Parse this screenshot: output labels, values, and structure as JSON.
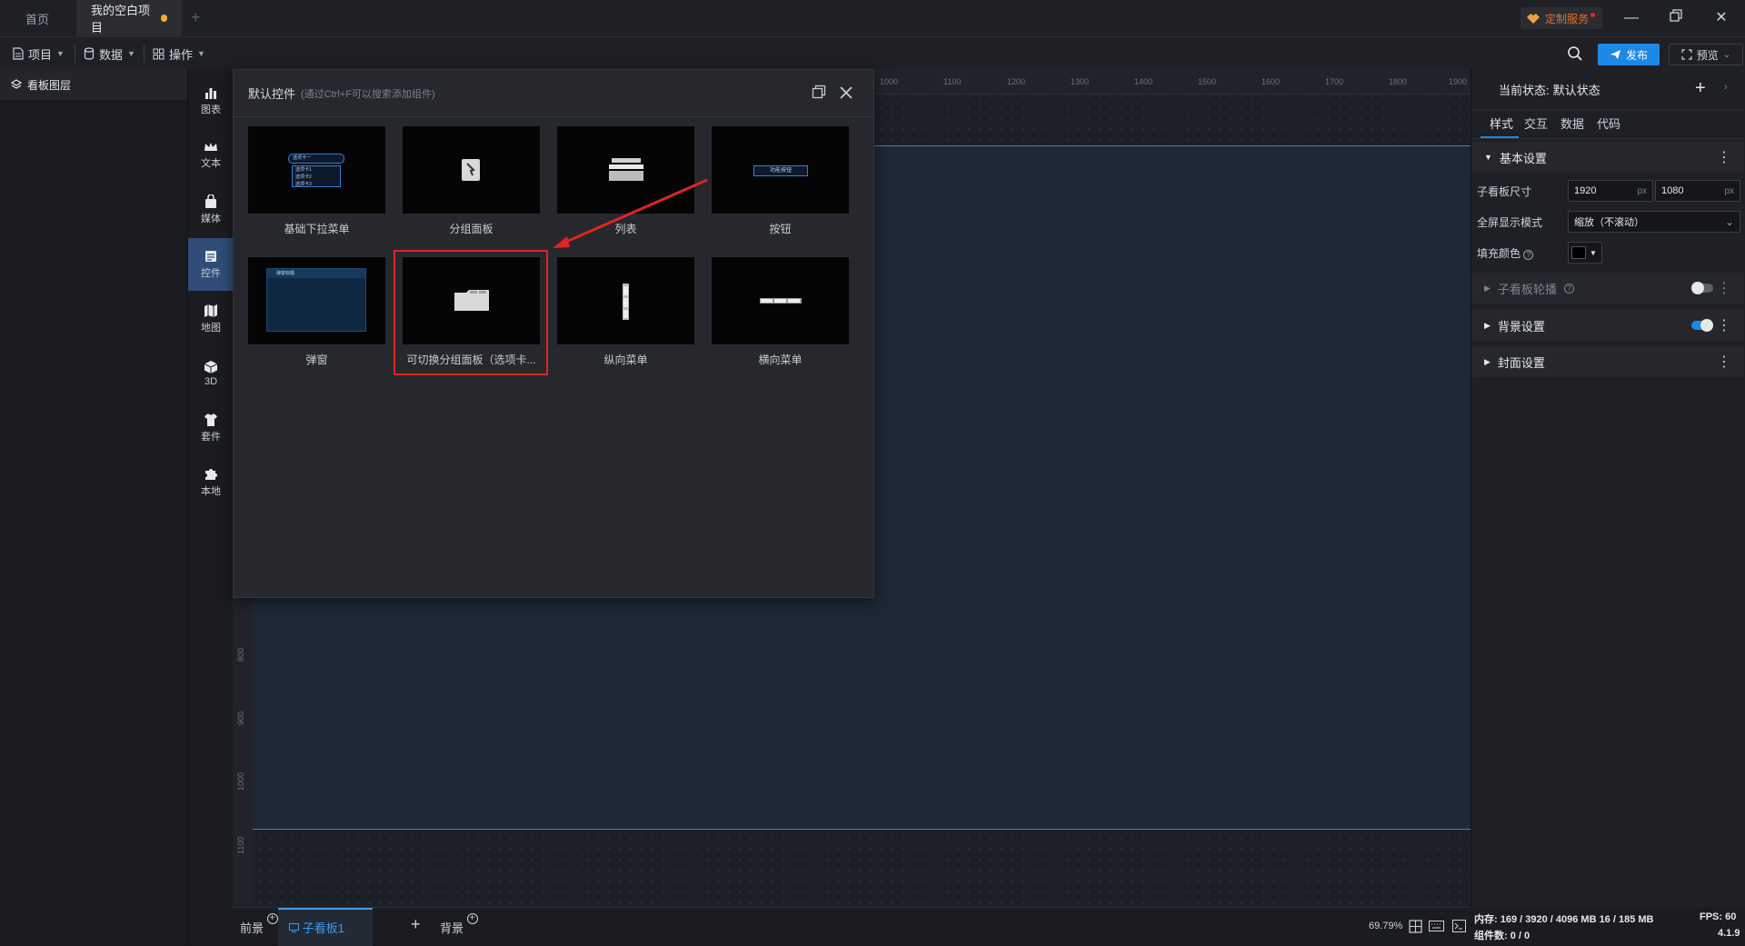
{
  "titlebar": {
    "tabs": [
      {
        "label": "首页"
      },
      {
        "label": "我的空白项目"
      }
    ],
    "custom_service": "定制服务"
  },
  "toolbar": {
    "project": "项目",
    "data": "数据",
    "operate": "操作",
    "publish": "发布",
    "preview": "预览"
  },
  "layers": {
    "title": "看板图层"
  },
  "categories": [
    {
      "label": "图表",
      "icon": "bar-chart-icon"
    },
    {
      "label": "文本",
      "icon": "crown-text-icon"
    },
    {
      "label": "媒体",
      "icon": "media-icon"
    },
    {
      "label": "控件",
      "icon": "control-icon"
    },
    {
      "label": "地图",
      "icon": "map-icon"
    },
    {
      "label": "3D",
      "icon": "cube-icon"
    },
    {
      "label": "套件",
      "icon": "shirt-icon"
    },
    {
      "label": "本地",
      "icon": "puzzle-icon"
    }
  ],
  "ruler": {
    "top": [
      "1000",
      "1100",
      "1200",
      "1300",
      "1400",
      "1500",
      "1600",
      "1700",
      "1800",
      "1900"
    ],
    "left": [
      "800",
      "900",
      "1000",
      "1100"
    ]
  },
  "popup": {
    "title": "默认控件",
    "hint": "(通过Ctrl+F可以搜索添加组件)",
    "components": [
      {
        "label": "基础下拉菜单"
      },
      {
        "label": "分组面板"
      },
      {
        "label": "列表"
      },
      {
        "label": "按钮"
      },
      {
        "label": "弹窗"
      },
      {
        "label": "可切换分组面板（选项卡..."
      },
      {
        "label": "纵向菜单"
      },
      {
        "label": "横向菜单"
      }
    ],
    "thumb_texts": {
      "dropdown_title": "选项卡一",
      "dropdown_items": [
        "选项卡1",
        "选项卡2",
        "选项卡3"
      ],
      "button": "功能按钮",
      "dialog_title": "弹窗标题"
    }
  },
  "right_panel": {
    "state_label": "当前状态:",
    "state_value": "默认状态",
    "tabs": [
      "样式",
      "交互",
      "数据",
      "代码"
    ],
    "basic_settings": "基本设置",
    "size_label": "子看板尺寸",
    "width": "1920",
    "height": "1080",
    "unit": "px",
    "fullscreen_label": "全屏显示模式",
    "fullscreen_value": "缩放（不滚动）",
    "fill_label": "填充颜色",
    "fill_color": "#000000",
    "carousel": "子看板轮播",
    "background": "背景设置",
    "cover": "封面设置"
  },
  "bottombar": {
    "foreground": "前景",
    "subboard": "子看板1",
    "background": "背景",
    "zoom": "69.79%"
  },
  "status": {
    "memory": "内存: 169 / 3920 / 4096 MB 16 / 185 MB",
    "fps": "FPS: 60",
    "components": "组件数: 0 / 0",
    "version": "4.1.9"
  }
}
